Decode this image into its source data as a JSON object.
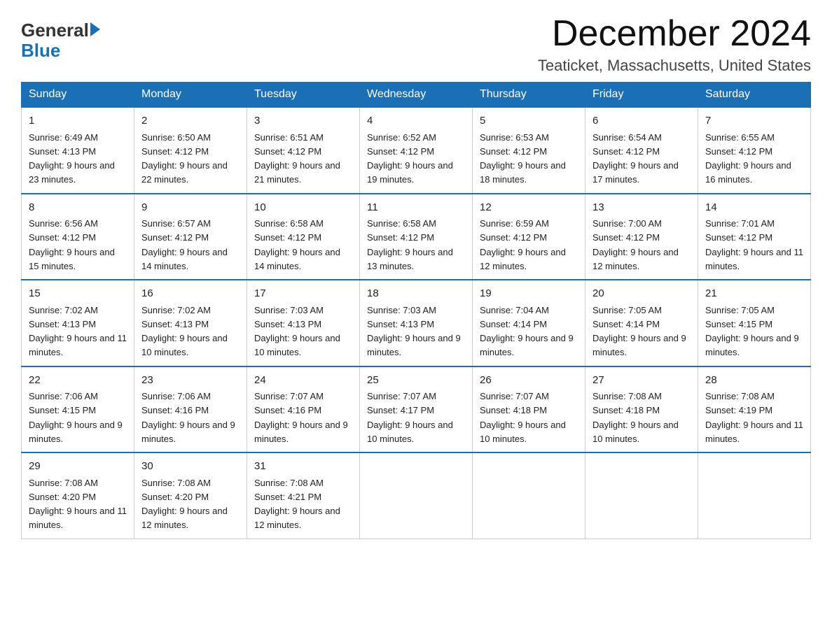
{
  "logo": {
    "text_general": "General",
    "text_blue": "Blue"
  },
  "title": "December 2024",
  "subtitle": "Teaticket, Massachusetts, United States",
  "weekdays": [
    "Sunday",
    "Monday",
    "Tuesday",
    "Wednesday",
    "Thursday",
    "Friday",
    "Saturday"
  ],
  "weeks": [
    [
      {
        "day": "1",
        "sunrise": "Sunrise: 6:49 AM",
        "sunset": "Sunset: 4:13 PM",
        "daylight": "Daylight: 9 hours and 23 minutes."
      },
      {
        "day": "2",
        "sunrise": "Sunrise: 6:50 AM",
        "sunset": "Sunset: 4:12 PM",
        "daylight": "Daylight: 9 hours and 22 minutes."
      },
      {
        "day": "3",
        "sunrise": "Sunrise: 6:51 AM",
        "sunset": "Sunset: 4:12 PM",
        "daylight": "Daylight: 9 hours and 21 minutes."
      },
      {
        "day": "4",
        "sunrise": "Sunrise: 6:52 AM",
        "sunset": "Sunset: 4:12 PM",
        "daylight": "Daylight: 9 hours and 19 minutes."
      },
      {
        "day": "5",
        "sunrise": "Sunrise: 6:53 AM",
        "sunset": "Sunset: 4:12 PM",
        "daylight": "Daylight: 9 hours and 18 minutes."
      },
      {
        "day": "6",
        "sunrise": "Sunrise: 6:54 AM",
        "sunset": "Sunset: 4:12 PM",
        "daylight": "Daylight: 9 hours and 17 minutes."
      },
      {
        "day": "7",
        "sunrise": "Sunrise: 6:55 AM",
        "sunset": "Sunset: 4:12 PM",
        "daylight": "Daylight: 9 hours and 16 minutes."
      }
    ],
    [
      {
        "day": "8",
        "sunrise": "Sunrise: 6:56 AM",
        "sunset": "Sunset: 4:12 PM",
        "daylight": "Daylight: 9 hours and 15 minutes."
      },
      {
        "day": "9",
        "sunrise": "Sunrise: 6:57 AM",
        "sunset": "Sunset: 4:12 PM",
        "daylight": "Daylight: 9 hours and 14 minutes."
      },
      {
        "day": "10",
        "sunrise": "Sunrise: 6:58 AM",
        "sunset": "Sunset: 4:12 PM",
        "daylight": "Daylight: 9 hours and 14 minutes."
      },
      {
        "day": "11",
        "sunrise": "Sunrise: 6:58 AM",
        "sunset": "Sunset: 4:12 PM",
        "daylight": "Daylight: 9 hours and 13 minutes."
      },
      {
        "day": "12",
        "sunrise": "Sunrise: 6:59 AM",
        "sunset": "Sunset: 4:12 PM",
        "daylight": "Daylight: 9 hours and 12 minutes."
      },
      {
        "day": "13",
        "sunrise": "Sunrise: 7:00 AM",
        "sunset": "Sunset: 4:12 PM",
        "daylight": "Daylight: 9 hours and 12 minutes."
      },
      {
        "day": "14",
        "sunrise": "Sunrise: 7:01 AM",
        "sunset": "Sunset: 4:12 PM",
        "daylight": "Daylight: 9 hours and 11 minutes."
      }
    ],
    [
      {
        "day": "15",
        "sunrise": "Sunrise: 7:02 AM",
        "sunset": "Sunset: 4:13 PM",
        "daylight": "Daylight: 9 hours and 11 minutes."
      },
      {
        "day": "16",
        "sunrise": "Sunrise: 7:02 AM",
        "sunset": "Sunset: 4:13 PM",
        "daylight": "Daylight: 9 hours and 10 minutes."
      },
      {
        "day": "17",
        "sunrise": "Sunrise: 7:03 AM",
        "sunset": "Sunset: 4:13 PM",
        "daylight": "Daylight: 9 hours and 10 minutes."
      },
      {
        "day": "18",
        "sunrise": "Sunrise: 7:03 AM",
        "sunset": "Sunset: 4:13 PM",
        "daylight": "Daylight: 9 hours and 9 minutes."
      },
      {
        "day": "19",
        "sunrise": "Sunrise: 7:04 AM",
        "sunset": "Sunset: 4:14 PM",
        "daylight": "Daylight: 9 hours and 9 minutes."
      },
      {
        "day": "20",
        "sunrise": "Sunrise: 7:05 AM",
        "sunset": "Sunset: 4:14 PM",
        "daylight": "Daylight: 9 hours and 9 minutes."
      },
      {
        "day": "21",
        "sunrise": "Sunrise: 7:05 AM",
        "sunset": "Sunset: 4:15 PM",
        "daylight": "Daylight: 9 hours and 9 minutes."
      }
    ],
    [
      {
        "day": "22",
        "sunrise": "Sunrise: 7:06 AM",
        "sunset": "Sunset: 4:15 PM",
        "daylight": "Daylight: 9 hours and 9 minutes."
      },
      {
        "day": "23",
        "sunrise": "Sunrise: 7:06 AM",
        "sunset": "Sunset: 4:16 PM",
        "daylight": "Daylight: 9 hours and 9 minutes."
      },
      {
        "day": "24",
        "sunrise": "Sunrise: 7:07 AM",
        "sunset": "Sunset: 4:16 PM",
        "daylight": "Daylight: 9 hours and 9 minutes."
      },
      {
        "day": "25",
        "sunrise": "Sunrise: 7:07 AM",
        "sunset": "Sunset: 4:17 PM",
        "daylight": "Daylight: 9 hours and 10 minutes."
      },
      {
        "day": "26",
        "sunrise": "Sunrise: 7:07 AM",
        "sunset": "Sunset: 4:18 PM",
        "daylight": "Daylight: 9 hours and 10 minutes."
      },
      {
        "day": "27",
        "sunrise": "Sunrise: 7:08 AM",
        "sunset": "Sunset: 4:18 PM",
        "daylight": "Daylight: 9 hours and 10 minutes."
      },
      {
        "day": "28",
        "sunrise": "Sunrise: 7:08 AM",
        "sunset": "Sunset: 4:19 PM",
        "daylight": "Daylight: 9 hours and 11 minutes."
      }
    ],
    [
      {
        "day": "29",
        "sunrise": "Sunrise: 7:08 AM",
        "sunset": "Sunset: 4:20 PM",
        "daylight": "Daylight: 9 hours and 11 minutes."
      },
      {
        "day": "30",
        "sunrise": "Sunrise: 7:08 AM",
        "sunset": "Sunset: 4:20 PM",
        "daylight": "Daylight: 9 hours and 12 minutes."
      },
      {
        "day": "31",
        "sunrise": "Sunrise: 7:08 AM",
        "sunset": "Sunset: 4:21 PM",
        "daylight": "Daylight: 9 hours and 12 minutes."
      },
      null,
      null,
      null,
      null
    ]
  ]
}
